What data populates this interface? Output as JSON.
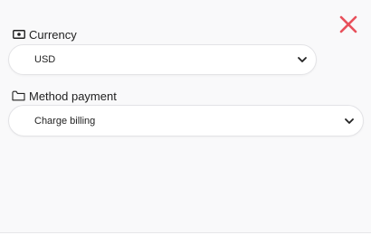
{
  "colors": {
    "close": "#e8505b",
    "text": "#1f1f1f",
    "panel_bg": "#f9f9fa",
    "field_bg": "#ffffff"
  },
  "icons": {
    "close": "close-icon",
    "currency": "banknote-icon",
    "method": "folder-icon",
    "dropdown": "chevron-down-icon"
  },
  "currency": {
    "label": "Currency",
    "value": "USD"
  },
  "method": {
    "label": "Method payment",
    "value": "Charge billing"
  }
}
